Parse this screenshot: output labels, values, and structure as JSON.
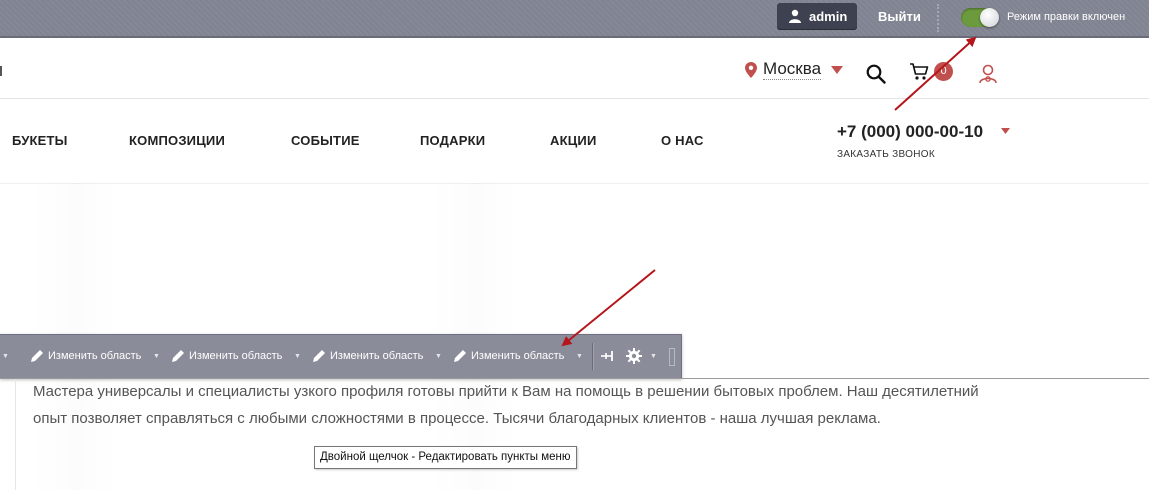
{
  "admin_bar": {
    "user_label": "admin",
    "logout_label": "Выйти",
    "edit_mode_label": "Режим правки включен",
    "edit_mode_on": true
  },
  "header": {
    "city": "Москва",
    "cart_count": "0",
    "icons": [
      "location-pin-icon",
      "caret-down-icon",
      "search-icon",
      "cart-icon",
      "user-icon"
    ]
  },
  "menu": {
    "items": [
      "БУКЕТЫ",
      "КОМПОЗИЦИИ",
      "СОБЫТИЕ",
      "ПОДАРКИ",
      "АКЦИИ",
      "О НАС"
    ],
    "phone": "+7 (000) 000-00-10",
    "callback_label": "ЗАКАЗАТЬ ЗВОНОК"
  },
  "edit_toolbar": {
    "items": [
      "Изменить область",
      "Изменить область",
      "Изменить область",
      "Изменить область"
    ],
    "icons": [
      "pencil-icon",
      "pin-icon",
      "gear-icon"
    ]
  },
  "content": {
    "text": "Мастера универсалы и специалисты узкого профиля готовы прийти к Вам на помощь в решении бытовых проблем. Наш десятилетний опыт позволяет справляться с любыми сложностями в процессе. Тысячи благодарных клиентов - наша лучшая реклама."
  },
  "tooltip": "Двойной щелчок - Редактировать пункты меню",
  "colors": {
    "admin_bar": "#808391",
    "accent": "#c0504d",
    "toggle_on": "#6c9b3d",
    "arrow": "#b5161c"
  }
}
